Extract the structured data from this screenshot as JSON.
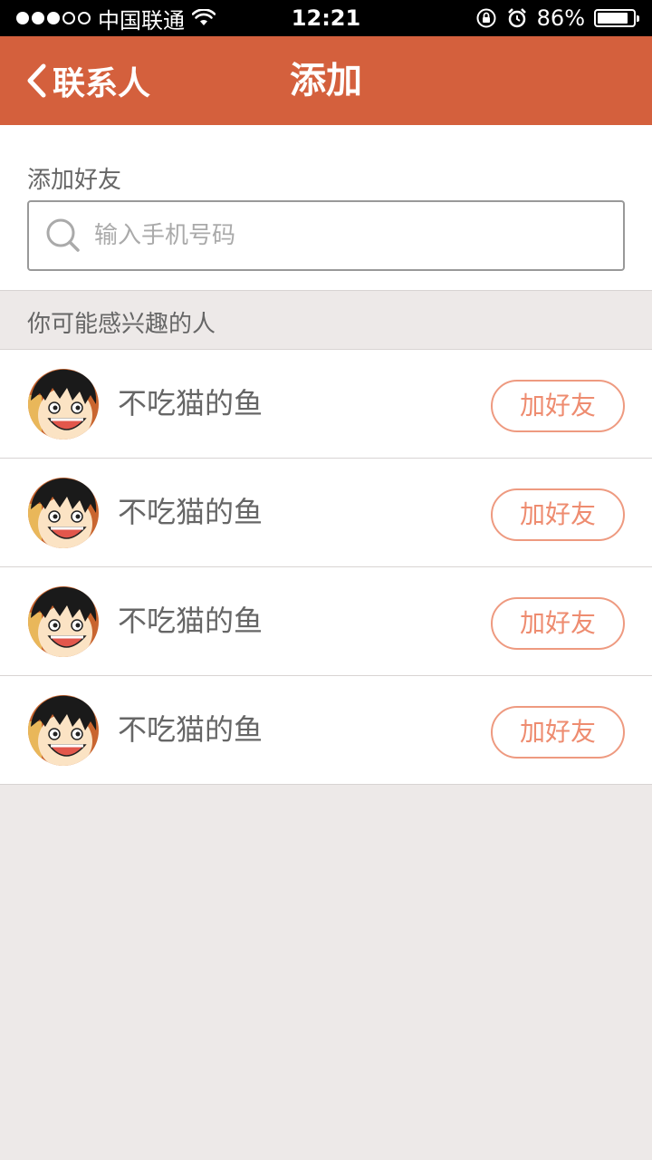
{
  "status_bar": {
    "carrier": "中国联通",
    "time": "12:21",
    "battery_text": "86%",
    "battery_level": 0.86
  },
  "nav": {
    "back_label": "联系人",
    "title": "添加"
  },
  "add_friend": {
    "label": "添加好友",
    "search_placeholder": "输入手机号码"
  },
  "suggestions": {
    "title": "你可能感兴趣的人",
    "items": [
      {
        "name": "不吃猫的鱼",
        "button": "加好友"
      },
      {
        "name": "不吃猫的鱼",
        "button": "加好友"
      },
      {
        "name": "不吃猫的鱼",
        "button": "加好友"
      },
      {
        "name": "不吃猫的鱼",
        "button": "加好友"
      }
    ]
  },
  "colors": {
    "accent": "#d4603d",
    "button_border": "#ee9a80",
    "background": "#ede9e8"
  }
}
